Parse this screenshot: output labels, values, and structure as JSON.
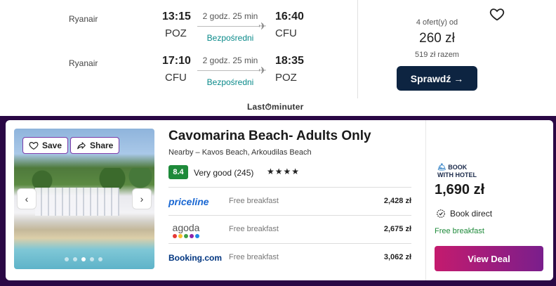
{
  "flight": {
    "outbound": {
      "airline": "Ryanair",
      "depart_time": "13:15",
      "depart_airport": "POZ",
      "duration": "2 godz. 25 min",
      "stops": "Bezpośredni",
      "arrive_time": "16:40",
      "arrive_airport": "CFU"
    },
    "return": {
      "airline": "Ryanair",
      "depart_time": "17:10",
      "depart_airport": "CFU",
      "duration": "2 godz. 25 min",
      "stops": "Bezpośredni",
      "arrive_time": "18:35",
      "arrive_airport": "POZ"
    },
    "offers_label": "4 ofert(y) od",
    "price": "260 zł",
    "total_price": "519 zł razem",
    "check_button": "Sprawdź →",
    "provider": "Last⏱minuter"
  },
  "hotel": {
    "save_label": "Save",
    "share_label": "Share",
    "name": "Cavomarina Beach- Adults Only",
    "nearby": "Nearby – Kavos Beach, Arkoudilas Beach",
    "rating_score": "8.4",
    "rating_text": "Very good (245)",
    "stars": "★★★★",
    "deals": [
      {
        "provider": "priceline",
        "feature": "Free breakfast",
        "price": "2,428 zł"
      },
      {
        "provider": "agoda",
        "feature": "Free breakfast",
        "price": "2,675 zł"
      },
      {
        "provider": "Booking.com",
        "feature": "Free breakfast",
        "price": "3,062 zł"
      }
    ],
    "featured": {
      "provider": "BOOK WITH HOTEL",
      "price": "1,690 zł",
      "book_direct": "Book direct",
      "feature": "Free breakfast",
      "button": "View Deal"
    }
  },
  "colors": {
    "check_button_bg": "#0d2441",
    "direct_text": "#0a8a8a",
    "rating_badge": "#1e8a3a",
    "section_bg": "#2a0845",
    "view_deal_gradient_start": "#c41b6e",
    "view_deal_gradient_end": "#7a1e8c"
  }
}
